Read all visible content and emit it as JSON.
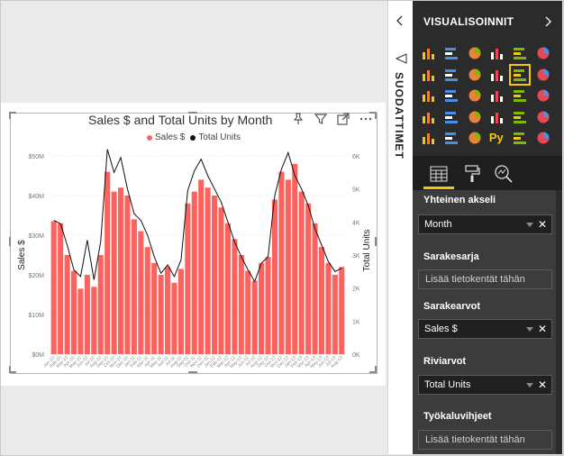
{
  "filters_pane": {
    "label": "SUODATTIMET"
  },
  "viz_pane": {
    "title": "VISUALISOINNIT",
    "gallery_icons": [
      "stacked-bar-icon",
      "stacked-column-icon",
      "clustered-bar-icon",
      "clustered-column-icon",
      "100-stacked-bar-icon",
      "100-stacked-column-icon",
      "line-chart-icon",
      "area-chart-icon",
      "stacked-area-icon",
      "line-stacked-column-icon",
      "line-clustered-column-icon",
      "ribbon-chart-icon",
      "waterfall-icon",
      "scatter-icon",
      "pie-chart-icon",
      "donut-chart-icon",
      "treemap-icon",
      "map-icon",
      "filled-map-icon",
      "funnel-icon",
      "gauge-icon",
      "card-icon",
      "multi-row-card-icon",
      "kpi-icon",
      "slicer-icon",
      "table-icon",
      "matrix-icon",
      "python-visual-icon",
      "key-influencers-icon",
      "arcgis-icon"
    ],
    "python_label": "Py",
    "more_label": "...",
    "selected_icon": "line-clustered-column-icon",
    "tabs": [
      "fields-tab",
      "format-tab",
      "analytics-tab"
    ],
    "wells": [
      {
        "label": "Yhteinen akseli",
        "field": "Month"
      },
      {
        "label": "Sarakesarja",
        "placeholder": "Lisää tietokentät tähän"
      },
      {
        "label": "Sarakearvot",
        "field": "Sales $"
      },
      {
        "label": "Riviarvot",
        "field": "Total Units"
      },
      {
        "label": "Työkaluvihjeet",
        "placeholder": "Lisää tietokentät tähän"
      }
    ]
  },
  "chart_data": {
    "type": "bar",
    "title": "Sales $ and Total Units by Month",
    "ylabel": "Sales $",
    "y2label": "Total Units",
    "legend": [
      "Sales $",
      "Total Units"
    ],
    "legend_position": "top",
    "colors": {
      "bar": "#fd625e",
      "line": "#111111"
    },
    "y_ticks": [
      "$0M",
      "$10M",
      "$20M",
      "$30M",
      "$40M",
      "$50M"
    ],
    "y2_ticks": [
      "0K",
      "1K",
      "2K",
      "3K",
      "4K",
      "5K",
      "6K"
    ],
    "ylim": [
      0,
      50
    ],
    "y2lim": [
      0,
      6
    ],
    "categories": [
      "Jan-10",
      "Feb-10",
      "Mar-10",
      "Apr-10",
      "May-10",
      "Jun-10",
      "Jul-10",
      "Aug-10",
      "Sep-10",
      "Oct-10",
      "Nov-10",
      "Dec-10",
      "Jan-11",
      "Feb-11",
      "Mar-11",
      "Apr-11",
      "May-11",
      "Jun-11",
      "Jul-11",
      "Aug-11",
      "Sep-11",
      "Oct-11",
      "Nov-11",
      "Dec-11",
      "Jan-12",
      "Feb-12",
      "Mar-12",
      "Apr-12",
      "May-12",
      "Jun-12",
      "Jul-12",
      "Aug-12",
      "Sep-12",
      "Oct-12",
      "Nov-12",
      "Dec-12",
      "Jan-13",
      "Feb-13",
      "Mar-13",
      "Apr-13",
      "May-13",
      "Jun-13",
      "Jul-13",
      "Aug-13"
    ],
    "series": [
      {
        "name": "Sales $",
        "values": [
          33.5,
          33,
          25,
          21,
          16.5,
          20,
          17,
          25,
          46,
          41,
          42,
          40,
          34,
          31,
          27,
          23,
          20,
          22,
          18,
          21.5,
          38,
          41,
          44,
          42,
          40,
          37,
          33,
          29,
          25,
          21,
          18.5,
          23,
          24.5,
          39,
          46,
          44,
          48,
          41,
          38,
          33,
          27,
          23,
          20,
          22
        ]
      },
      {
        "name": "Total Units",
        "values": [
          4.05,
          3.95,
          3.3,
          2.55,
          2.35,
          3.45,
          2.25,
          3.4,
          6.2,
          5.5,
          5.95,
          5.0,
          4.25,
          4.05,
          3.6,
          2.95,
          2.45,
          2.7,
          2.35,
          2.85,
          4.95,
          5.55,
          5.9,
          5.4,
          5.0,
          4.6,
          4.0,
          3.4,
          2.95,
          2.55,
          2.2,
          2.75,
          2.95,
          4.8,
          5.6,
          6.1,
          5.4,
          5.0,
          4.5,
          3.8,
          3.3,
          2.8,
          2.5,
          2.6
        ]
      }
    ]
  }
}
